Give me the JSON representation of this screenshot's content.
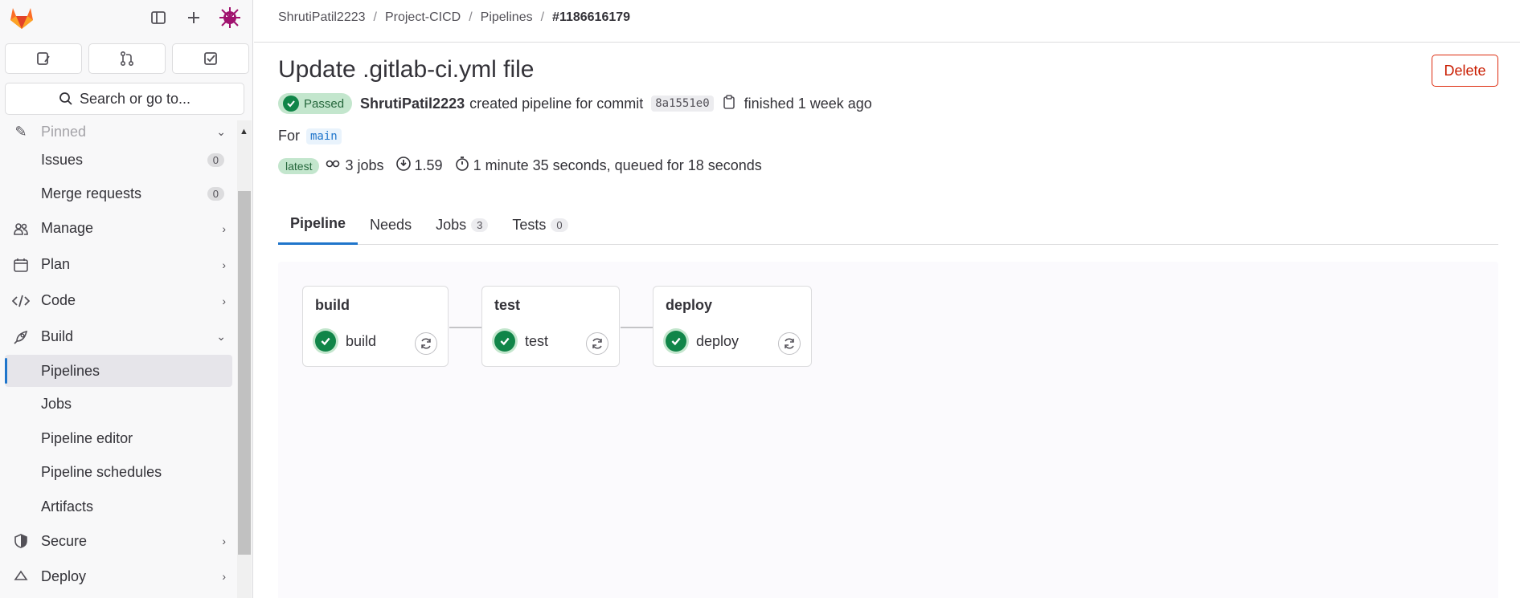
{
  "sidebar": {
    "search_placeholder": "Search or go to...",
    "items": [
      {
        "label": "Pinned",
        "faded": true
      },
      {
        "label": "Issues",
        "count": "0"
      },
      {
        "label": "Merge requests",
        "count": "0"
      },
      {
        "label": "Manage",
        "icon": "users-icon"
      },
      {
        "label": "Plan",
        "icon": "calendar-icon"
      },
      {
        "label": "Code",
        "icon": "code-icon"
      },
      {
        "label": "Build",
        "icon": "rocket-icon"
      },
      {
        "label": "Pipelines",
        "active": true
      },
      {
        "label": "Jobs"
      },
      {
        "label": "Pipeline editor"
      },
      {
        "label": "Pipeline schedules"
      },
      {
        "label": "Artifacts"
      },
      {
        "label": "Secure",
        "icon": "shield-icon"
      },
      {
        "label": "Deploy",
        "icon": "deploy-icon"
      }
    ]
  },
  "breadcrumb": [
    "ShrutiPatil2223",
    "Project-CICD",
    "Pipelines",
    "#1186616179"
  ],
  "pipeline": {
    "title": "Update .gitlab-ci.yml file",
    "delete_label": "Delete",
    "status": "Passed",
    "author": "ShrutiPatil2223",
    "created_text": "created pipeline for commit",
    "commit": "8a1551e0",
    "finished_text": "finished 1 week ago",
    "for_label": "For",
    "branch": "main",
    "latest_badge": "latest",
    "jobs_count": "3 jobs",
    "coverage": "1.59",
    "duration": "1 minute 35 seconds, queued for 18 seconds"
  },
  "tabs": [
    {
      "label": "Pipeline",
      "active": true
    },
    {
      "label": "Needs"
    },
    {
      "label": "Jobs",
      "count": "3"
    },
    {
      "label": "Tests",
      "count": "0"
    }
  ],
  "stages": [
    {
      "name": "build",
      "job": "build"
    },
    {
      "name": "test",
      "job": "test"
    },
    {
      "name": "deploy",
      "job": "deploy"
    }
  ],
  "colors": {
    "accent": "#1f75cb",
    "success": "#108548",
    "danger": "#dd2b0e"
  }
}
